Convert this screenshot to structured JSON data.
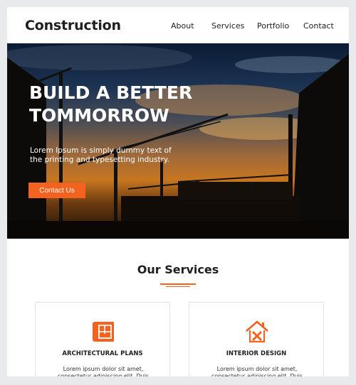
{
  "header": {
    "brand": "Construction",
    "nav": [
      "About",
      "Services",
      "Portfolio",
      "Contact"
    ]
  },
  "hero": {
    "title_line1": "BUILD A BETTER",
    "title_line2": "TOMMORROW",
    "text": "Lorem Ipsum is simply dummy text of the printing and typesetting industry.",
    "button": "Contact Us"
  },
  "services": {
    "title": "Our Services",
    "cards": [
      {
        "icon": "blueprint-icon",
        "title": "ARCHITECTURAL PLANS",
        "desc": "Lorem ipsum dolor sit amet, consectetur adipiscing elit. Duis vehicula dui sit"
      },
      {
        "icon": "house-tools-icon",
        "title": "INTERIOR DESIGN",
        "desc": "Lorem ipsum dolor sit amet, consectetur adipiscing elit. Duis vehicula dui sit"
      }
    ]
  },
  "colors": {
    "accent": "#f4621f",
    "text": "#1f1f1f",
    "background": "#e9eaec"
  }
}
